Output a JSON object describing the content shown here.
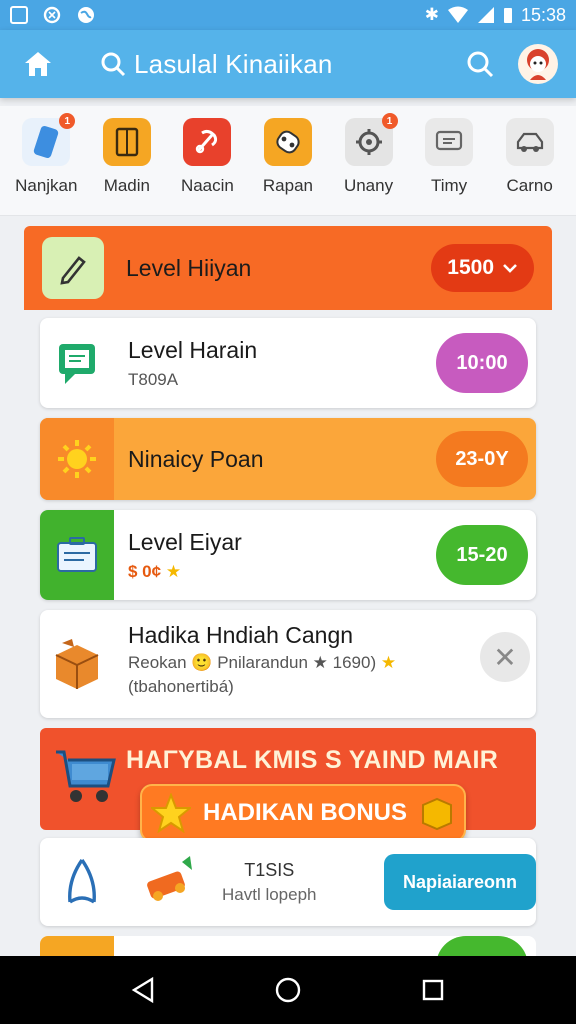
{
  "status_bar": {
    "time": "15:38",
    "left_icons": [
      "image-icon",
      "sync-icon",
      "globe-icon"
    ],
    "right_icons": [
      "bluetooth-icon",
      "wifi-icon",
      "signal-icon",
      "battery-icon"
    ]
  },
  "app_bar": {
    "title": "Lasulal Kinaiikan",
    "icons": [
      "home-icon",
      "search-icon",
      "search-icon",
      "avatar-icon"
    ]
  },
  "categories": [
    {
      "label": "Nanjkan",
      "icon": "phone-icon",
      "badge": "1",
      "color": "#5aa0e0"
    },
    {
      "label": "Madin",
      "icon": "document-icon",
      "badge": "",
      "color": "#f5a623"
    },
    {
      "label": "Naacin",
      "icon": "tool-icon",
      "badge": "",
      "color": "#e8412c"
    },
    {
      "label": "Rapan",
      "icon": "controller-icon",
      "badge": "",
      "color": "#f5a623"
    },
    {
      "label": "Unany",
      "icon": "gear-icon",
      "badge": "1",
      "color": "#dddddd"
    },
    {
      "label": "Timy",
      "icon": "message-icon",
      "badge": "",
      "color": "#e8e8e8"
    },
    {
      "label": "Carno",
      "icon": "car-icon",
      "badge": "",
      "color": "#e8e8e8"
    }
  ],
  "level_header": {
    "title": "Level Hiiyan",
    "pill": "1500",
    "icon": "pencil-icon"
  },
  "cards": [
    {
      "title": "Level Harain",
      "sub": "T809A",
      "pill": "10:00",
      "pill_color": "#c75bbf",
      "bg": "#ffffff",
      "icon": "chat-icon"
    },
    {
      "title": "Ninaicy Poan",
      "sub": "",
      "pill": "23-0Y",
      "pill_color": "#f47a1f",
      "bg": "#fba63a",
      "icon": "sun-icon"
    },
    {
      "title": "Level Eiyar",
      "sub": "$ 0¢",
      "pill": "15-20",
      "pill_color": "#45b82e",
      "bg": "#ffffff",
      "icon": "register-icon"
    },
    {
      "title": "Hadika Hndiah Cangn",
      "sub": "Reokan 🙂 Pnilarandun ★ 1690)",
      "sub2": "(tbahonertibá)",
      "bg": "#ffffff",
      "icon": "box-icon"
    }
  ],
  "bonus": {
    "title": "HAΓYBAL KMIS S YAIND MAIR",
    "button": "HADIKAN BONUS"
  },
  "promo": {
    "code": "T1SIS",
    "sub": "Havtl lopeph",
    "button": "Napiaiareonn"
  },
  "nav": [
    "back-icon",
    "home-circle-icon",
    "recents-icon"
  ]
}
